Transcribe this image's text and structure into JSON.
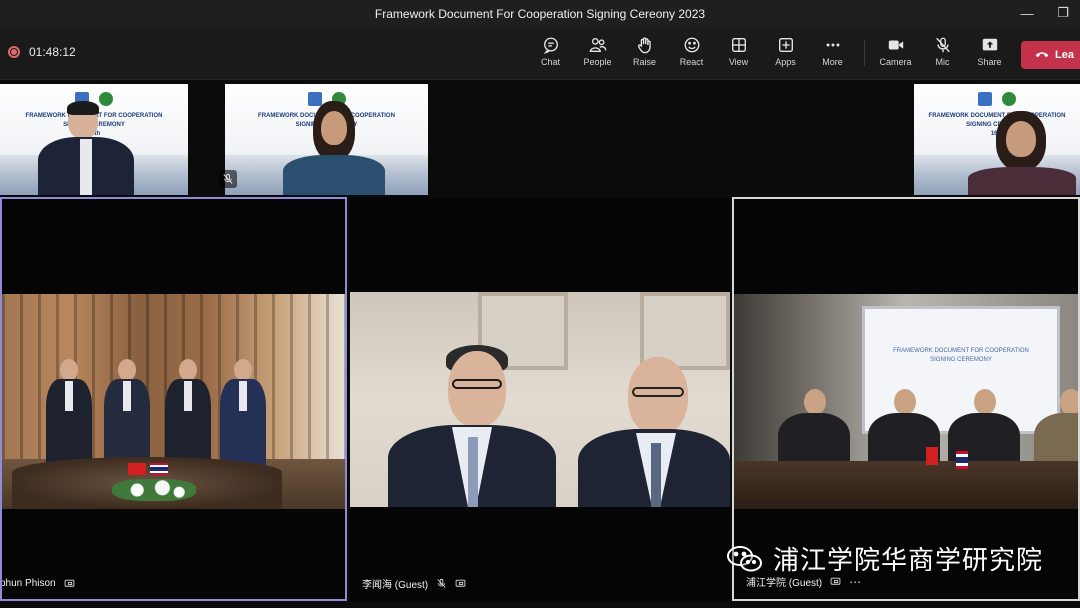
{
  "window": {
    "title": "Framework Document For Cooperation Signing Cereony 2023"
  },
  "toolbar": {
    "recording_time": "01:48:12",
    "items": [
      {
        "label": "Chat",
        "icon": "chat-icon"
      },
      {
        "label": "People",
        "icon": "people-icon"
      },
      {
        "label": "Raise",
        "icon": "raise-hand-icon"
      },
      {
        "label": "React",
        "icon": "react-icon"
      },
      {
        "label": "View",
        "icon": "view-icon"
      },
      {
        "label": "Apps",
        "icon": "apps-icon"
      },
      {
        "label": "More",
        "icon": "more-icon"
      }
    ],
    "device_items": [
      {
        "label": "Camera",
        "icon": "camera-icon"
      },
      {
        "label": "Mic",
        "icon": "mic-muted-icon"
      },
      {
        "label": "Share",
        "icon": "share-icon"
      }
    ],
    "leave_label": "Lea"
  },
  "slide": {
    "line1": "FRAMEWORK DOCUMENT FOR COOPERATION",
    "line2": "SIGNING CEREMONY",
    "line3": "16th"
  },
  "tiles": [
    {
      "name": "phun Phison"
    },
    {
      "name": "李闻海 (Guest)"
    },
    {
      "name": "浦江学院 (Guest)"
    }
  ],
  "colors": {
    "accent_active_border": "#8e8cd8",
    "leave_red": "#c4314b",
    "recording_red": "#e06a6a"
  },
  "watermark": {
    "text": "浦江学院华商学研究院"
  }
}
